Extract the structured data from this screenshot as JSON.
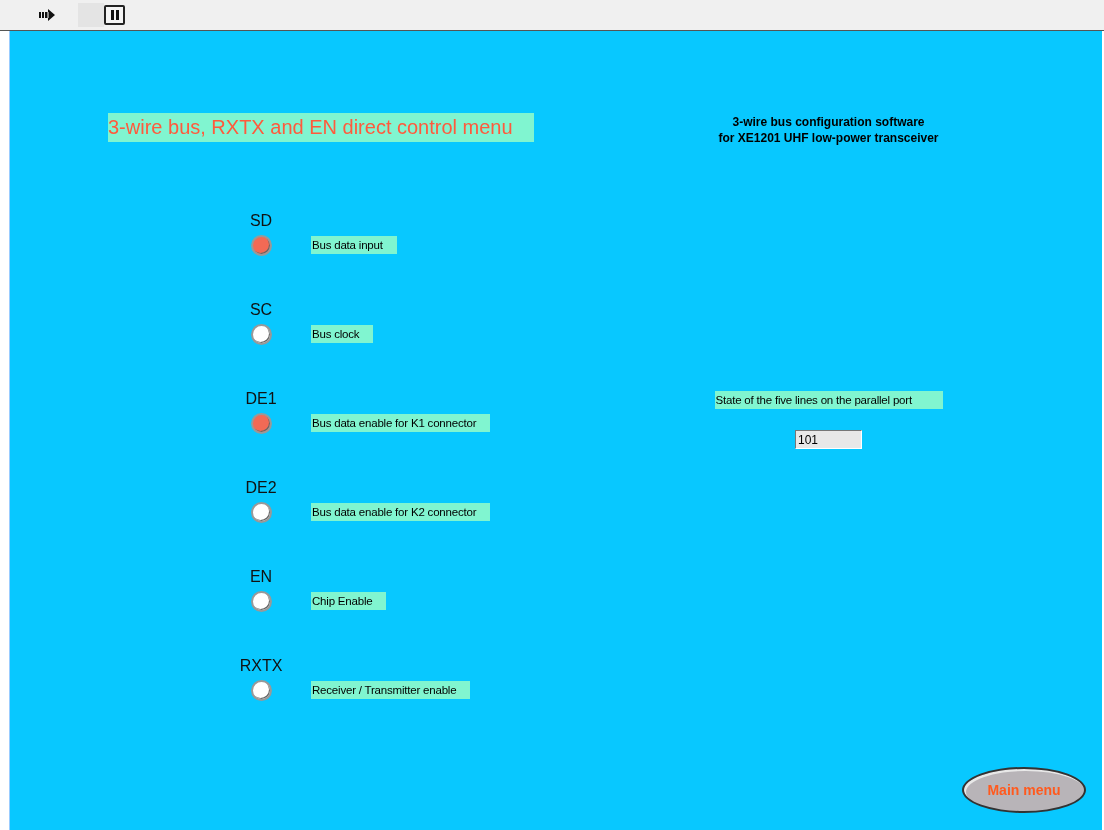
{
  "panel_title": "3-wire bus, RXTX and EN direct control menu",
  "header_lines": [
    "3-wire bus configuration software",
    "for XE1201 UHF low-power transceiver"
  ],
  "lines": [
    {
      "name": "SD",
      "description": "Bus data input",
      "on": true
    },
    {
      "name": "SC",
      "description": "Bus clock",
      "on": false
    },
    {
      "name": "DE1",
      "description": "Bus data enable for K1 connector",
      "on": true
    },
    {
      "name": "DE2",
      "description": "Bus data enable for K2 connector",
      "on": false
    },
    {
      "name": "EN",
      "description": "Chip Enable",
      "on": false
    },
    {
      "name": "RXTX",
      "description": "Receiver / Transmitter enable",
      "on": false
    }
  ],
  "parallel_port": {
    "label": "State of the five lines on the parallel port",
    "value": "101"
  },
  "main_menu_button": "Main menu"
}
